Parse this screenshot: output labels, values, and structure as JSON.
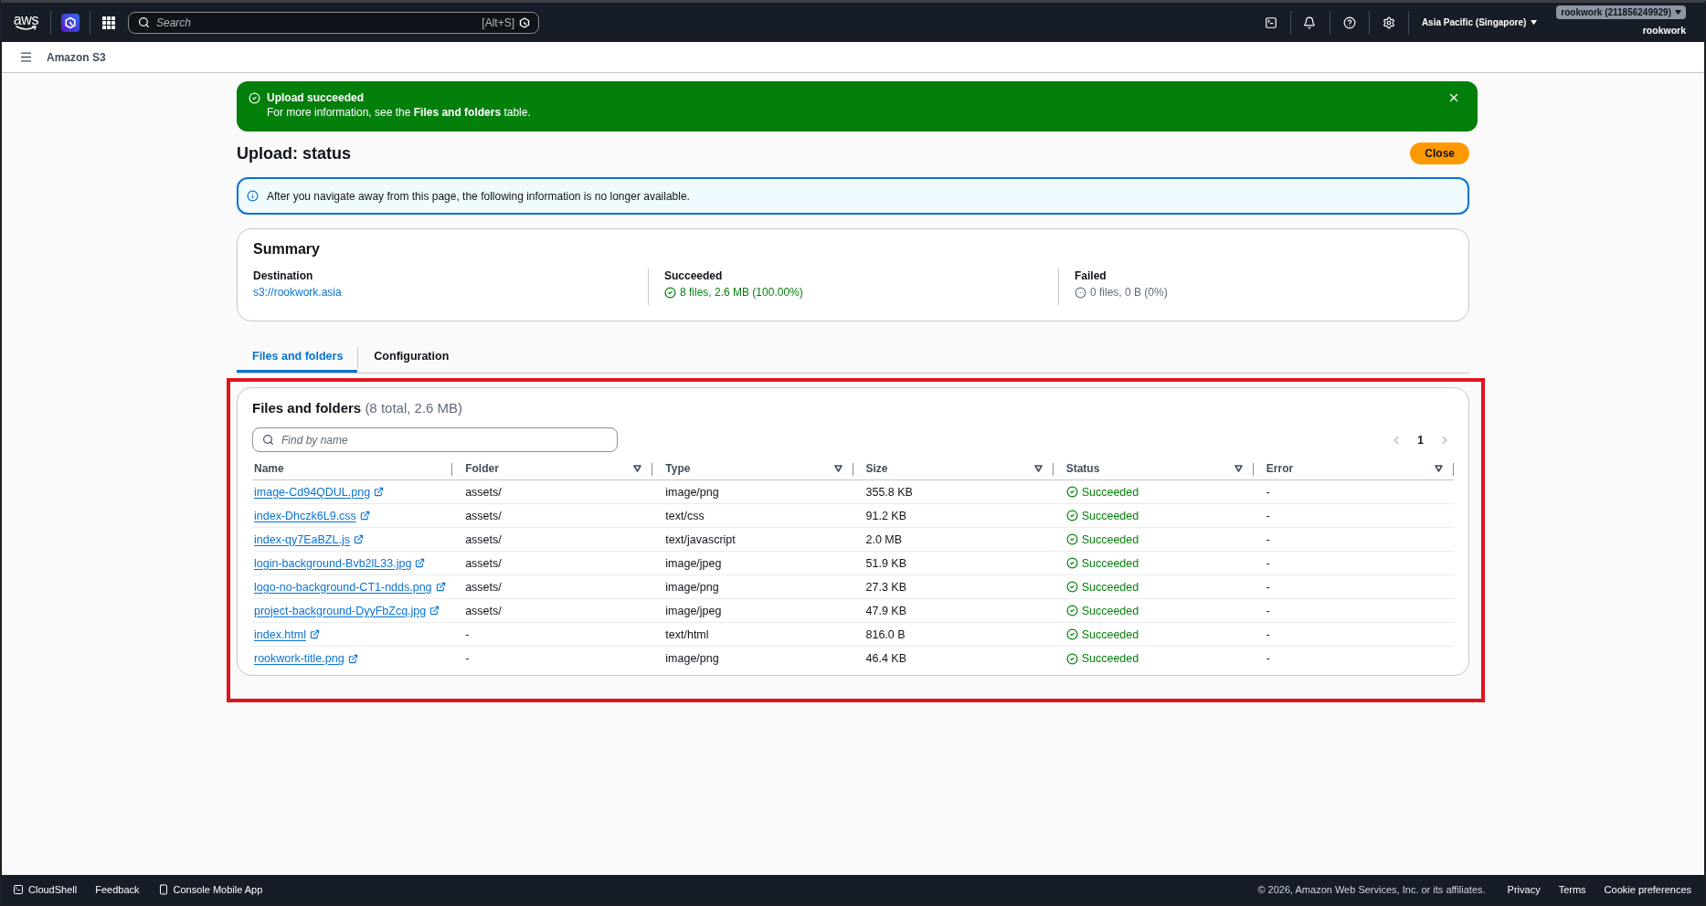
{
  "top_nav": {
    "logo": "aws",
    "search": {
      "placeholder": "Search",
      "shortcut": "[Alt+S]"
    },
    "region": "Asia Pacific (Singapore)",
    "account": "rookwork (211856249929)",
    "user": "rookwork"
  },
  "service_bar": {
    "title": "Amazon S3"
  },
  "flash": {
    "kind": "success",
    "title": "Upload succeeded",
    "message": "For more information, see the **Files and folders** table."
  },
  "header": {
    "title": "Upload: status",
    "close_button": "Close"
  },
  "info_alert": {
    "message": "After you navigate away from this page, the following information is no longer available."
  },
  "summary": {
    "title": "Summary",
    "items": [
      {
        "label": "Destination",
        "value": "s3://rookwork.asia",
        "kind": "link"
      },
      {
        "label": "Succeeded",
        "value": "8 files, 2.6 MB (100.00%)",
        "kind": "success"
      },
      {
        "label": "Failed",
        "value": "0 files, 0 B (0%)",
        "kind": "neutral"
      }
    ]
  },
  "tabs": [
    {
      "label": "Files and folders",
      "selected": true
    },
    {
      "label": "Configuration",
      "selected": false
    }
  ],
  "files_panel": {
    "highlighted": true,
    "title": "Files and folders",
    "counter": "(8 total, 2.6 MB)",
    "search": {
      "placeholder": "Find by name"
    },
    "pagination": {
      "previous_disabled": true,
      "next_disabled": true,
      "pages": [
        {
          "label": "1",
          "selected": true
        }
      ]
    },
    "table": {
      "columns": [
        {
          "label": "Name",
          "sortable": false
        },
        {
          "label": "Folder",
          "sortable": true
        },
        {
          "label": "Type",
          "sortable": true
        },
        {
          "label": "Size",
          "sortable": true
        },
        {
          "label": "Status",
          "sortable": true
        },
        {
          "label": "Error",
          "sortable": true
        }
      ],
      "rows": [
        {
          "name": "image-Cd94QDUL.png",
          "folder": "assets/",
          "type": "image/png",
          "size": "355.8 KB",
          "status": {
            "label": "Succeeded",
            "kind": "success"
          },
          "error": "-"
        },
        {
          "name": "index-Dhczk6L9.css",
          "folder": "assets/",
          "type": "text/css",
          "size": "91.2 KB",
          "status": {
            "label": "Succeeded",
            "kind": "success"
          },
          "error": "-"
        },
        {
          "name": "index-qy7EaBZL.js",
          "folder": "assets/",
          "type": "text/javascript",
          "size": "2.0 MB",
          "status": {
            "label": "Succeeded",
            "kind": "success"
          },
          "error": "-"
        },
        {
          "name": "login-background-Bvb2lL33.jpg",
          "folder": "assets/",
          "type": "image/jpeg",
          "size": "51.9 KB",
          "status": {
            "label": "Succeeded",
            "kind": "success"
          },
          "error": "-"
        },
        {
          "name": "logo-no-background-CT1-ndds.png",
          "folder": "assets/",
          "type": "image/png",
          "size": "27.3 KB",
          "status": {
            "label": "Succeeded",
            "kind": "success"
          },
          "error": "-"
        },
        {
          "name": "project-background-DyyFbZcq.jpg",
          "folder": "assets/",
          "type": "image/jpeg",
          "size": "47.9 KB",
          "status": {
            "label": "Succeeded",
            "kind": "success"
          },
          "error": "-"
        },
        {
          "name": "index.html",
          "folder": "-",
          "type": "text/html",
          "size": "816.0 B",
          "status": {
            "label": "Succeeded",
            "kind": "success"
          },
          "error": "-"
        },
        {
          "name": "rookwork-title.png",
          "folder": "-",
          "type": "image/png",
          "size": "46.4 KB",
          "status": {
            "label": "Succeeded",
            "kind": "success"
          },
          "error": "-"
        }
      ]
    }
  },
  "footer": {
    "items": [
      {
        "label": "CloudShell",
        "kind": "shell"
      },
      {
        "label": "Feedback",
        "kind": "plain"
      },
      {
        "label": "Console Mobile App",
        "kind": "app"
      }
    ],
    "copyright": "© 2026, Amazon Web Services, Inc. or its affiliates.",
    "links": [
      "Privacy",
      "Terms",
      "Cookie preferences"
    ]
  }
}
